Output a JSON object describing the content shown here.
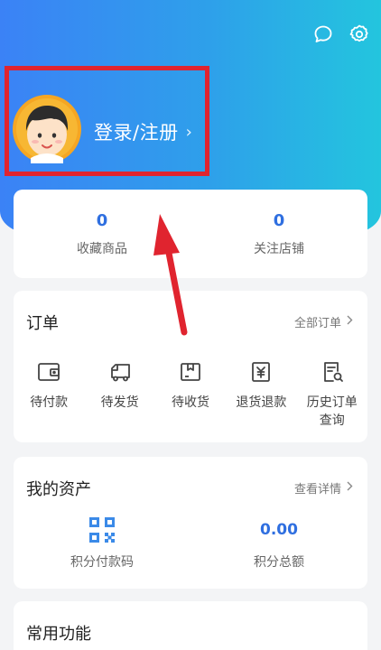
{
  "header": {
    "login_label": "登录/注册",
    "login_arrow": "›",
    "icons": [
      "message-icon",
      "settings-icon"
    ],
    "gradient_colors": [
      "#3b82f6",
      "#23c5de"
    ]
  },
  "favorites": {
    "items": [
      {
        "count": "0",
        "label": "收藏商品"
      },
      {
        "count": "0",
        "label": "关注店铺"
      }
    ]
  },
  "orders": {
    "title": "订单",
    "all_link": "全部订单",
    "items": [
      {
        "label": "待付款",
        "icon": "wallet-icon"
      },
      {
        "label": "待发货",
        "icon": "truck-icon"
      },
      {
        "label": "待收货",
        "icon": "package-icon"
      },
      {
        "label": "退货退款",
        "icon": "refund-icon"
      },
      {
        "label": "历史订单查询",
        "icon": "history-search-icon"
      }
    ]
  },
  "assets": {
    "title": "我的资产",
    "detail_link": "查看详情",
    "items": [
      {
        "value": "",
        "label": "积分付款码",
        "icon": "qr-code-icon"
      },
      {
        "value": "0.00",
        "label": "积分总额"
      }
    ]
  },
  "common": {
    "title": "常用功能"
  },
  "colors": {
    "accent_blue": "#2f6fe0",
    "highlight_red": "#e0242f"
  }
}
